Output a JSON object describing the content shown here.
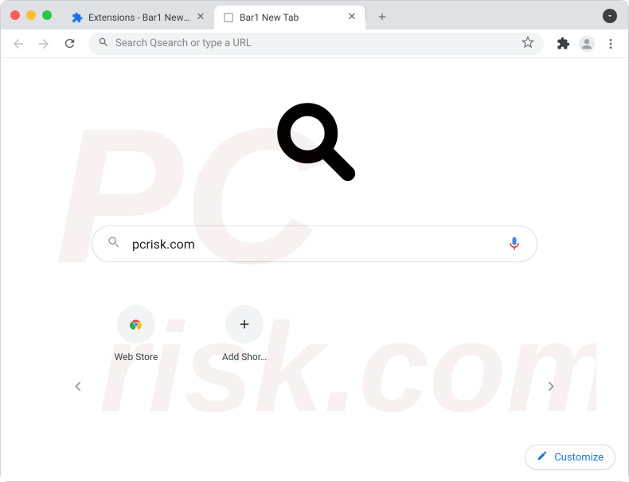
{
  "window": {
    "tabs": [
      {
        "title": "Extensions - Bar1 New Tab",
        "active": false,
        "favicon": "puzzle"
      },
      {
        "title": "Bar1 New Tab",
        "active": true,
        "favicon": "blank"
      }
    ]
  },
  "toolbar": {
    "omnibox_placeholder": "Search Qsearch or type a URL"
  },
  "page": {
    "search_value": "pcrisk.com",
    "shortcuts": [
      {
        "label": "Web Store",
        "icon": "webstore"
      },
      {
        "label": "Add Shor…",
        "icon": "plus"
      }
    ],
    "customize_label": "Customize"
  },
  "watermark": {
    "line1": "PC",
    "line2": "risk.com"
  }
}
